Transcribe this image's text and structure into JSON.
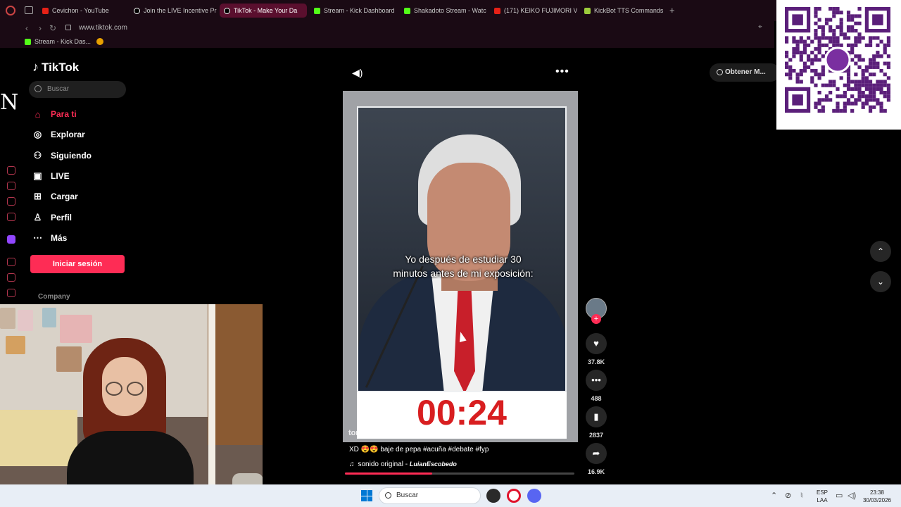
{
  "browser": {
    "tabs": [
      {
        "label": "Cevichon - YouTube",
        "favicon": "youtube-icon"
      },
      {
        "label": "Join the LIVE Incentive Pr",
        "favicon": "tiktok-icon"
      },
      {
        "label": "TikTok - Make Your Da",
        "favicon": "tiktok-icon",
        "active": true
      },
      {
        "label": "Stream - Kick Dashboard",
        "favicon": "kick-icon"
      },
      {
        "label": "Shakadoto Stream - Watc",
        "favicon": "kick-icon"
      },
      {
        "label": "(171) KEIKO FUJIMORI VS",
        "favicon": "youtube-icon"
      },
      {
        "label": "KickBot TTS Commands",
        "favicon": "kickbot-icon"
      }
    ],
    "url": "www.tiktok.com",
    "bookmarks": [
      "Stream - Kick Das..."
    ]
  },
  "side_strip": {
    "letter": "N"
  },
  "tiktok": {
    "logo": "TikTok",
    "search_placeholder": "Buscar",
    "nav": [
      {
        "label": "Para ti",
        "icon": "home-icon"
      },
      {
        "label": "Explorar",
        "icon": "compass-icon"
      },
      {
        "label": "Siguiendo",
        "icon": "following-icon"
      },
      {
        "label": "LIVE",
        "icon": "live-icon"
      },
      {
        "label": "Cargar",
        "icon": "upload-icon"
      },
      {
        "label": "Perfil",
        "icon": "profile-icon"
      },
      {
        "label": "Más",
        "icon": "more-icon"
      }
    ],
    "login_label": "Iniciar sesión",
    "company_label": "Company",
    "get_app_label": "Obtener M...",
    "video": {
      "caption_line1": "Yo después de estudiar 30",
      "caption_line2": "minutos antes de mi exposición:",
      "timer": "00:24",
      "watermark": "tommy.clipss",
      "description": "XD 😍😍 baje de pepa #acuña #debate #fyp",
      "sound_prefix": "sonido original - ",
      "sound_author": "LuianEscobedo",
      "progress": 0.38
    },
    "actions": {
      "likes": "37.8K",
      "comments": "488",
      "saves": "2837",
      "shares": "16.9K"
    }
  },
  "taskbar": {
    "search_placeholder": "Buscar",
    "lang_top": "ESP",
    "lang_bottom": "LAA",
    "time": "23:38",
    "date": "30/03/2026"
  },
  "colors": {
    "accent": "#fe2c55",
    "chrome_bg": "#1a0a14",
    "timer_red": "#d81e20",
    "qr_purple": "#5b1f7a"
  }
}
